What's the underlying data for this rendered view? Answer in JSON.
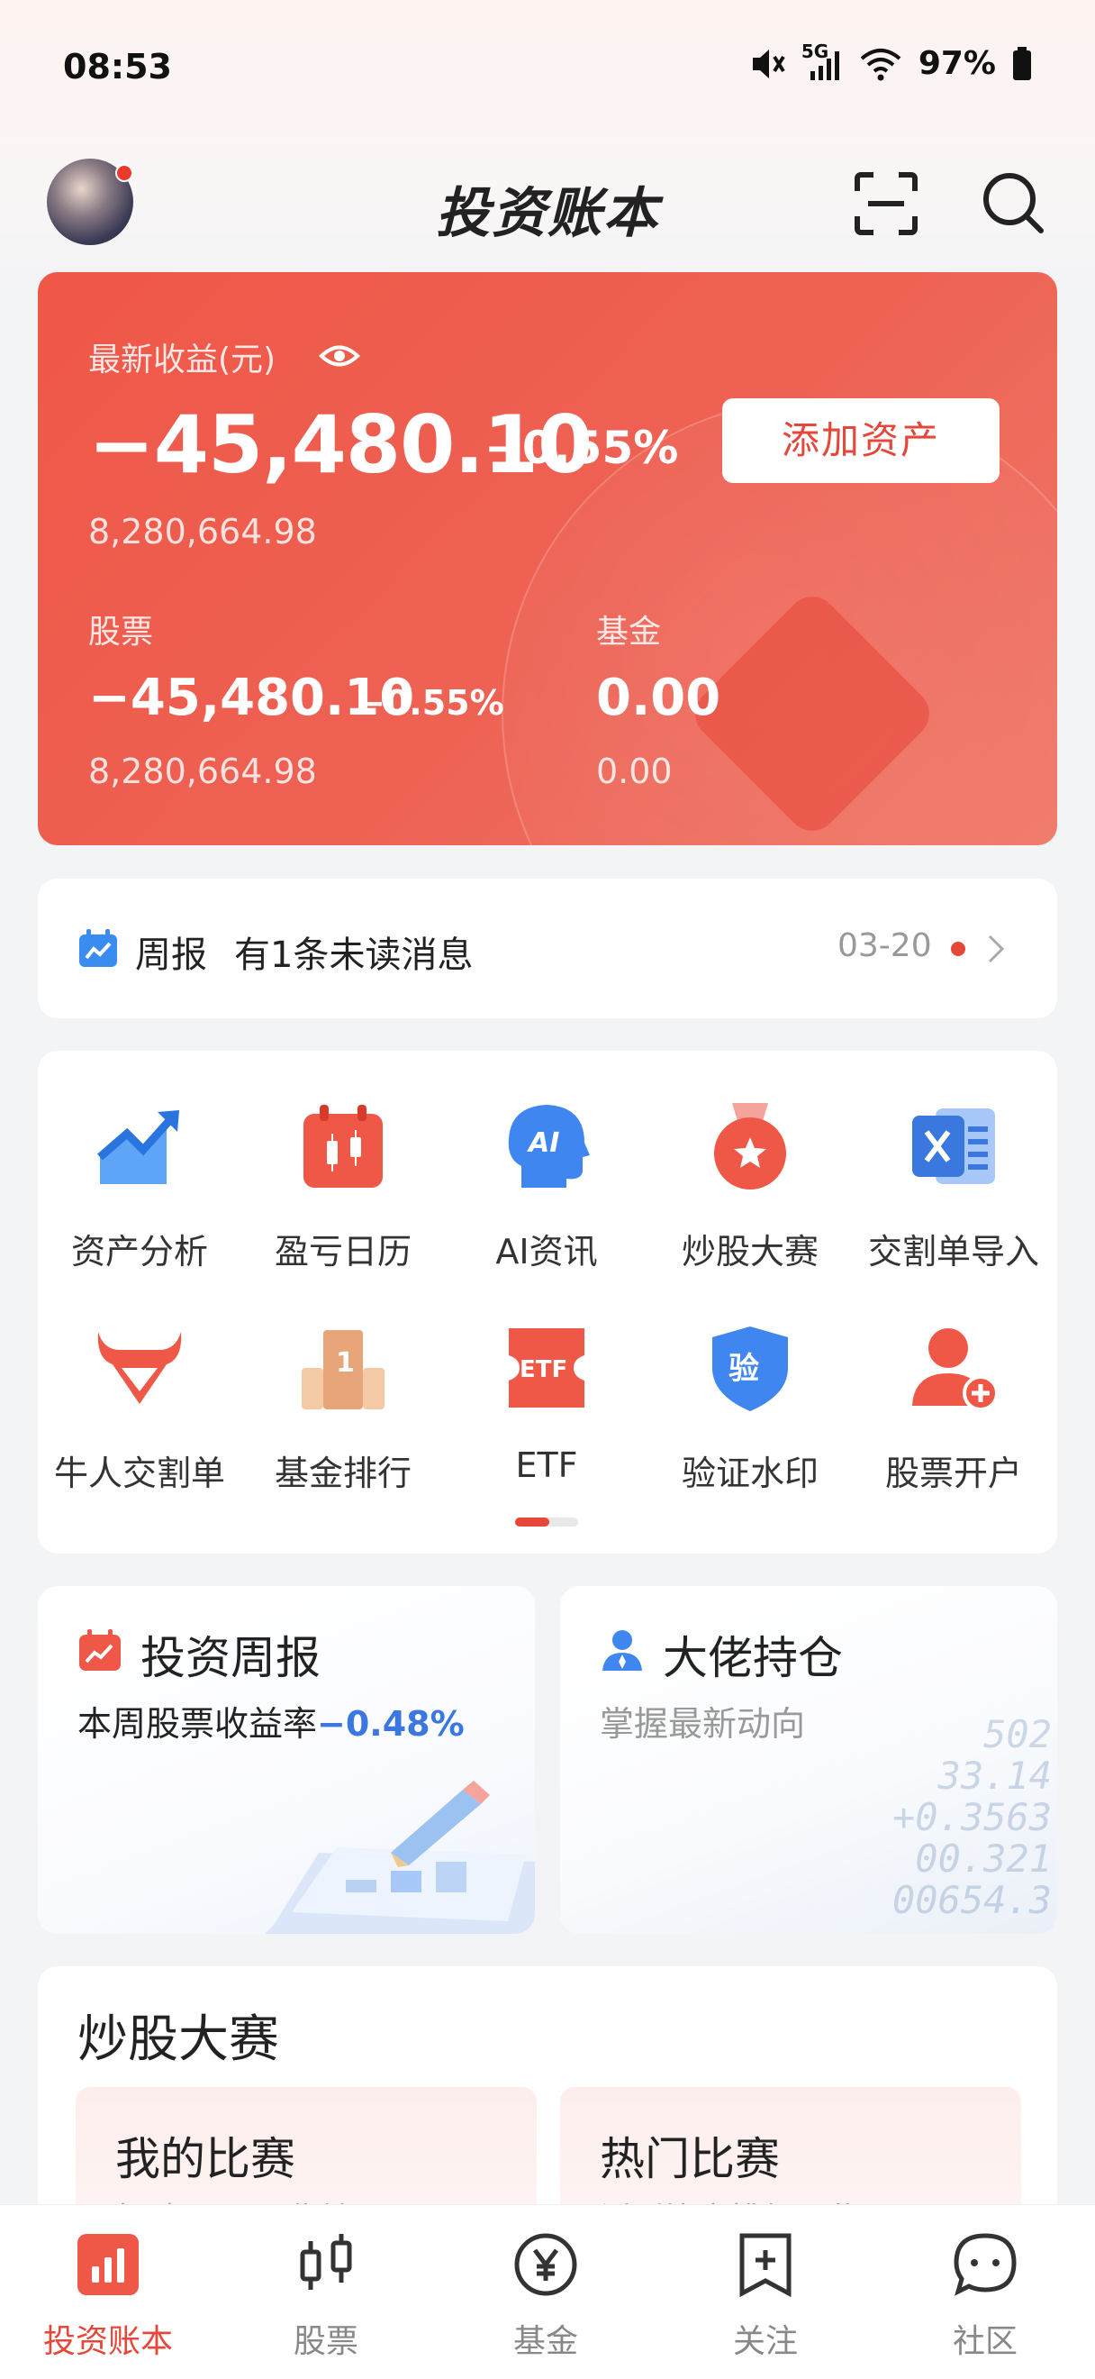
{
  "status_bar": {
    "time": "08:53",
    "network": "5G",
    "battery": "97%",
    "icons": [
      "mute-icon",
      "signal-icon",
      "wifi-icon",
      "battery-icon"
    ]
  },
  "header": {
    "title": "投资账本",
    "icons": [
      "avatar",
      "scan-icon",
      "search-icon"
    ]
  },
  "summary": {
    "latest_label": "最新收益(元)",
    "latest_value": "−45,480.10",
    "latest_pct": "−0.55%",
    "total_assets": "8,280,664.98",
    "add_asset_label": "添加资产",
    "stock_label": "股票",
    "stock_value": "−45,480.10",
    "stock_pct": "−0.55%",
    "stock_total": "8,280,664.98",
    "fund_label": "基金",
    "fund_value": "0.00",
    "fund_total": "0.00"
  },
  "report": {
    "title": "周报",
    "message": "有1条未读消息",
    "date": "03-20"
  },
  "grid": {
    "items": [
      {
        "label": "资产分析",
        "icon": "chart-up-icon"
      },
      {
        "label": "盈亏日历",
        "icon": "calendar-candle-icon"
      },
      {
        "label": "AI资讯",
        "icon": "ai-head-icon"
      },
      {
        "label": "炒股大赛",
        "icon": "medal-icon"
      },
      {
        "label": "交割单导入",
        "icon": "excel-icon"
      },
      {
        "label": "牛人交割单",
        "icon": "bull-icon"
      },
      {
        "label": "基金排行",
        "icon": "podium-icon"
      },
      {
        "label": "ETF",
        "icon": "etf-ticket-icon"
      },
      {
        "label": "验证水印",
        "icon": "verify-shield-icon"
      },
      {
        "label": "股票开户",
        "icon": "add-user-icon"
      }
    ],
    "pager": {
      "pages": 2,
      "current": 1
    }
  },
  "features": {
    "weekly": {
      "title": "投资周报",
      "subtitle_prefix": "本周股票收益率",
      "subtitle_value": "−0.48%"
    },
    "holdings": {
      "title": "大佬持仓",
      "subtitle": "掌握最新动向",
      "deco_numbers": [
        "502",
        "33.14",
        "+0.3563",
        "00.321",
        "00654.3"
      ]
    }
  },
  "contest": {
    "title": "炒股大赛",
    "my": {
      "title": "我的比赛",
      "subtitle": "打破圈子PK收益"
    },
    "hot": {
      "title": "热门比赛",
      "subtitle": "活跃比赛排行，监"
    }
  },
  "bottom_nav": {
    "items": [
      {
        "label": "投资账本",
        "icon": "ledger-icon",
        "active": true
      },
      {
        "label": "股票",
        "icon": "candlestick-icon",
        "active": false
      },
      {
        "label": "基金",
        "icon": "yen-icon",
        "active": false
      },
      {
        "label": "关注",
        "icon": "bookmark-plus-icon",
        "active": false
      },
      {
        "label": "社区",
        "icon": "chat-icon",
        "active": false
      }
    ]
  },
  "colors": {
    "accent": "#e5483a",
    "card_red": "#ef5747",
    "negative_blue": "#3a78e0"
  }
}
